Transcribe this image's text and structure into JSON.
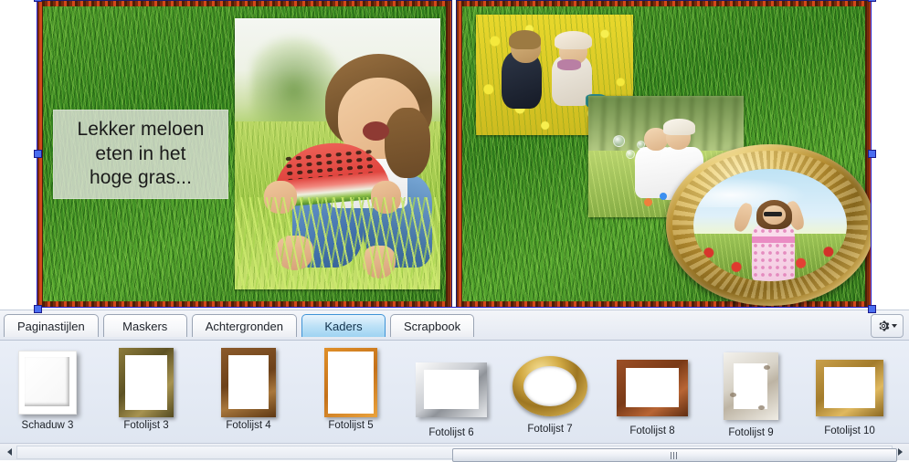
{
  "app": {
    "canvas": {
      "pages": [
        {
          "name": "left-page",
          "textbox": {
            "lines": [
              "Lekker meloen",
              "eten in het",
              "hoge gras..."
            ],
            "text": "Lekker meloen eten in het hoge gras..."
          },
          "photos": [
            {
              "name": "girl-eating-watermelon",
              "alt": "Girl eating a slice of watermelon in the grass"
            }
          ]
        },
        {
          "name": "right-page",
          "photos": [
            {
              "name": "children-in-dandelion-field",
              "alt": "Two children playing in a field of dandelions"
            },
            {
              "name": "children-blowing-bubbles",
              "alt": "Two children blowing soap bubbles on a lawn"
            },
            {
              "name": "girl-in-poppy-field-oval-frame",
              "alt": "Girl with arms raised in a poppy field, in an ornate gold oval frame"
            }
          ]
        }
      ],
      "selection": {
        "selected": true,
        "handle_color": "#4a6df0",
        "border_color": "#2222cc"
      }
    },
    "tabbar": {
      "tabs": [
        {
          "label": "Paginastijlen",
          "active": false
        },
        {
          "label": "Maskers",
          "active": false
        },
        {
          "label": "Achtergronden",
          "active": false
        },
        {
          "label": "Kaders",
          "active": true
        },
        {
          "label": "Scrapbook",
          "active": false
        }
      ],
      "options_button": {
        "icon": "gear-icon",
        "caret": "chevron-down-icon"
      }
    },
    "thumbnails": [
      {
        "label": "Schaduw 3",
        "style": "shadow3"
      },
      {
        "label": "Fotolijst 3",
        "style": "f3"
      },
      {
        "label": "Fotolijst 4",
        "style": "f4"
      },
      {
        "label": "Fotolijst 5",
        "style": "f5"
      },
      {
        "label": "Fotolijst 6",
        "style": "f6"
      },
      {
        "label": "Fotolijst 7",
        "style": "f7"
      },
      {
        "label": "Fotolijst 8",
        "style": "f8"
      },
      {
        "label": "Fotolijst 9",
        "style": "f9"
      },
      {
        "label": "Fotolijst 10",
        "style": "f10"
      }
    ],
    "scrollbar": {
      "left_arrow": "scroll-left-icon",
      "right_arrow": "scroll-right-icon",
      "grip": "scroll-thumb-grip"
    },
    "colors": {
      "accent": "#3f93d6",
      "tab_active_bg": "#9ed3f2",
      "panel_bg": "#e9eef7",
      "selection": "#2222cc"
    }
  }
}
